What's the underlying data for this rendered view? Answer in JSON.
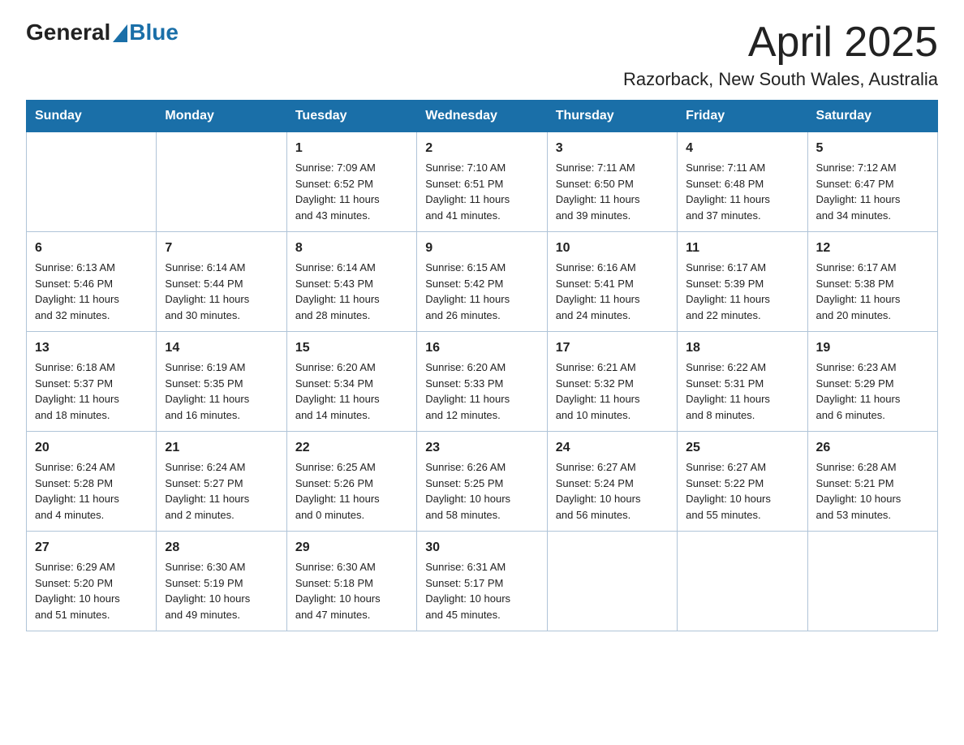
{
  "logo": {
    "general": "General",
    "blue": "Blue"
  },
  "header": {
    "month": "April 2025",
    "location": "Razorback, New South Wales, Australia"
  },
  "days_of_week": [
    "Sunday",
    "Monday",
    "Tuesday",
    "Wednesday",
    "Thursday",
    "Friday",
    "Saturday"
  ],
  "weeks": [
    [
      {
        "day": "",
        "sunrise": "",
        "sunset": "",
        "daylight": ""
      },
      {
        "day": "",
        "sunrise": "",
        "sunset": "",
        "daylight": ""
      },
      {
        "day": "1",
        "sunrise": "Sunrise: 7:09 AM",
        "sunset": "Sunset: 6:52 PM",
        "daylight": "Daylight: 11 hours and 43 minutes."
      },
      {
        "day": "2",
        "sunrise": "Sunrise: 7:10 AM",
        "sunset": "Sunset: 6:51 PM",
        "daylight": "Daylight: 11 hours and 41 minutes."
      },
      {
        "day": "3",
        "sunrise": "Sunrise: 7:11 AM",
        "sunset": "Sunset: 6:50 PM",
        "daylight": "Daylight: 11 hours and 39 minutes."
      },
      {
        "day": "4",
        "sunrise": "Sunrise: 7:11 AM",
        "sunset": "Sunset: 6:48 PM",
        "daylight": "Daylight: 11 hours and 37 minutes."
      },
      {
        "day": "5",
        "sunrise": "Sunrise: 7:12 AM",
        "sunset": "Sunset: 6:47 PM",
        "daylight": "Daylight: 11 hours and 34 minutes."
      }
    ],
    [
      {
        "day": "6",
        "sunrise": "Sunrise: 6:13 AM",
        "sunset": "Sunset: 5:46 PM",
        "daylight": "Daylight: 11 hours and 32 minutes."
      },
      {
        "day": "7",
        "sunrise": "Sunrise: 6:14 AM",
        "sunset": "Sunset: 5:44 PM",
        "daylight": "Daylight: 11 hours and 30 minutes."
      },
      {
        "day": "8",
        "sunrise": "Sunrise: 6:14 AM",
        "sunset": "Sunset: 5:43 PM",
        "daylight": "Daylight: 11 hours and 28 minutes."
      },
      {
        "day": "9",
        "sunrise": "Sunrise: 6:15 AM",
        "sunset": "Sunset: 5:42 PM",
        "daylight": "Daylight: 11 hours and 26 minutes."
      },
      {
        "day": "10",
        "sunrise": "Sunrise: 6:16 AM",
        "sunset": "Sunset: 5:41 PM",
        "daylight": "Daylight: 11 hours and 24 minutes."
      },
      {
        "day": "11",
        "sunrise": "Sunrise: 6:17 AM",
        "sunset": "Sunset: 5:39 PM",
        "daylight": "Daylight: 11 hours and 22 minutes."
      },
      {
        "day": "12",
        "sunrise": "Sunrise: 6:17 AM",
        "sunset": "Sunset: 5:38 PM",
        "daylight": "Daylight: 11 hours and 20 minutes."
      }
    ],
    [
      {
        "day": "13",
        "sunrise": "Sunrise: 6:18 AM",
        "sunset": "Sunset: 5:37 PM",
        "daylight": "Daylight: 11 hours and 18 minutes."
      },
      {
        "day": "14",
        "sunrise": "Sunrise: 6:19 AM",
        "sunset": "Sunset: 5:35 PM",
        "daylight": "Daylight: 11 hours and 16 minutes."
      },
      {
        "day": "15",
        "sunrise": "Sunrise: 6:20 AM",
        "sunset": "Sunset: 5:34 PM",
        "daylight": "Daylight: 11 hours and 14 minutes."
      },
      {
        "day": "16",
        "sunrise": "Sunrise: 6:20 AM",
        "sunset": "Sunset: 5:33 PM",
        "daylight": "Daylight: 11 hours and 12 minutes."
      },
      {
        "day": "17",
        "sunrise": "Sunrise: 6:21 AM",
        "sunset": "Sunset: 5:32 PM",
        "daylight": "Daylight: 11 hours and 10 minutes."
      },
      {
        "day": "18",
        "sunrise": "Sunrise: 6:22 AM",
        "sunset": "Sunset: 5:31 PM",
        "daylight": "Daylight: 11 hours and 8 minutes."
      },
      {
        "day": "19",
        "sunrise": "Sunrise: 6:23 AM",
        "sunset": "Sunset: 5:29 PM",
        "daylight": "Daylight: 11 hours and 6 minutes."
      }
    ],
    [
      {
        "day": "20",
        "sunrise": "Sunrise: 6:24 AM",
        "sunset": "Sunset: 5:28 PM",
        "daylight": "Daylight: 11 hours and 4 minutes."
      },
      {
        "day": "21",
        "sunrise": "Sunrise: 6:24 AM",
        "sunset": "Sunset: 5:27 PM",
        "daylight": "Daylight: 11 hours and 2 minutes."
      },
      {
        "day": "22",
        "sunrise": "Sunrise: 6:25 AM",
        "sunset": "Sunset: 5:26 PM",
        "daylight": "Daylight: 11 hours and 0 minutes."
      },
      {
        "day": "23",
        "sunrise": "Sunrise: 6:26 AM",
        "sunset": "Sunset: 5:25 PM",
        "daylight": "Daylight: 10 hours and 58 minutes."
      },
      {
        "day": "24",
        "sunrise": "Sunrise: 6:27 AM",
        "sunset": "Sunset: 5:24 PM",
        "daylight": "Daylight: 10 hours and 56 minutes."
      },
      {
        "day": "25",
        "sunrise": "Sunrise: 6:27 AM",
        "sunset": "Sunset: 5:22 PM",
        "daylight": "Daylight: 10 hours and 55 minutes."
      },
      {
        "day": "26",
        "sunrise": "Sunrise: 6:28 AM",
        "sunset": "Sunset: 5:21 PM",
        "daylight": "Daylight: 10 hours and 53 minutes."
      }
    ],
    [
      {
        "day": "27",
        "sunrise": "Sunrise: 6:29 AM",
        "sunset": "Sunset: 5:20 PM",
        "daylight": "Daylight: 10 hours and 51 minutes."
      },
      {
        "day": "28",
        "sunrise": "Sunrise: 6:30 AM",
        "sunset": "Sunset: 5:19 PM",
        "daylight": "Daylight: 10 hours and 49 minutes."
      },
      {
        "day": "29",
        "sunrise": "Sunrise: 6:30 AM",
        "sunset": "Sunset: 5:18 PM",
        "daylight": "Daylight: 10 hours and 47 minutes."
      },
      {
        "day": "30",
        "sunrise": "Sunrise: 6:31 AM",
        "sunset": "Sunset: 5:17 PM",
        "daylight": "Daylight: 10 hours and 45 minutes."
      },
      {
        "day": "",
        "sunrise": "",
        "sunset": "",
        "daylight": ""
      },
      {
        "day": "",
        "sunrise": "",
        "sunset": "",
        "daylight": ""
      },
      {
        "day": "",
        "sunrise": "",
        "sunset": "",
        "daylight": ""
      }
    ]
  ]
}
